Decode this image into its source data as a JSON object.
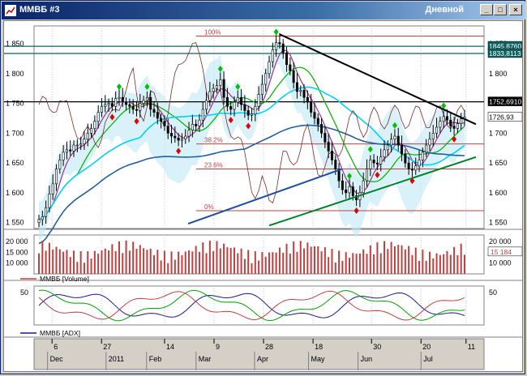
{
  "window": {
    "title": "ММВБ #3",
    "mode": "Дневной",
    "buttons": {
      "minimize": "_",
      "maximize": "□",
      "close": "×"
    }
  },
  "chart_data": [
    {
      "type": "candlestick",
      "title": "",
      "y_ticks": [
        "1 850",
        "1 800",
        "1 750",
        "1 700",
        "1 650",
        "1 600",
        "1 550"
      ],
      "ylim": [
        1540,
        1880
      ],
      "price_labels": [
        {
          "text": "1845,8760",
          "value": 1845.876,
          "bg": "#106060",
          "fg": "#ffffff"
        },
        {
          "text": "1833,8113",
          "value": 1833.811,
          "bg": "#106060",
          "fg": "#ffffff"
        },
        {
          "text": "1752,6910",
          "value": 1752.691,
          "bg": "#000000",
          "fg": "#ffffff"
        },
        {
          "text": "1726,93",
          "value": 1726.93,
          "bg": "#ffffff",
          "fg": "#000000"
        }
      ],
      "fibonacci": [
        {
          "text": "100%",
          "value": 1863
        },
        {
          "text": "38.2%",
          "value": 1682
        },
        {
          "text": "23.6%",
          "value": 1640
        },
        {
          "text": "0%",
          "value": 1570
        }
      ],
      "close": [
        1555,
        1560,
        1575,
        1598,
        1615,
        1640,
        1655,
        1668,
        1672,
        1670,
        1680,
        1680,
        1682,
        1690,
        1700,
        1708,
        1720,
        1735,
        1745,
        1748,
        1750,
        1745,
        1758,
        1760,
        1752,
        1748,
        1745,
        1740,
        1738,
        1750,
        1755,
        1760,
        1740,
        1735,
        1725,
        1720,
        1712,
        1700,
        1695,
        1692,
        1688,
        1690,
        1695,
        1705,
        1715,
        1712,
        1722,
        1740,
        1755,
        1770,
        1775,
        1780,
        1790,
        1760,
        1745,
        1740,
        1752,
        1760,
        1748,
        1738,
        1730,
        1732,
        1745,
        1765,
        1782,
        1800,
        1820,
        1840,
        1852,
        1850,
        1835,
        1815,
        1805,
        1785,
        1770,
        1772,
        1760,
        1752,
        1735,
        1725,
        1715,
        1700,
        1685,
        1670,
        1655,
        1640,
        1620,
        1605,
        1600,
        1610,
        1595,
        1588,
        1600,
        1620,
        1640,
        1655,
        1650,
        1648,
        1660,
        1672,
        1680,
        1690,
        1695,
        1680,
        1665,
        1650,
        1640,
        1638,
        1645,
        1655,
        1668,
        1680,
        1690,
        1700,
        1710,
        1720,
        1728,
        1722,
        1712,
        1708,
        1716,
        1724,
        1727
      ],
      "volume_panel": {
        "series": "ММВБ [Volume]",
        "y_ticks": [
          "20 000",
          "15 000",
          "10 000"
        ],
        "last": "15 184",
        "ylim": [
          5000,
          23000
        ]
      },
      "adx_panel": {
        "series": "ММВБ [ADX]",
        "y_ticks": [
          "50"
        ],
        "ylim": [
          0,
          60
        ]
      },
      "x_axis": {
        "days": [
          "6",
          "27",
          "14",
          "9",
          "28",
          "18",
          "30",
          "20",
          "11"
        ],
        "months": [
          "Dec",
          "2011",
          "Feb",
          "Mar",
          "Apr",
          "May",
          "Jun",
          "Jul"
        ]
      }
    }
  ]
}
